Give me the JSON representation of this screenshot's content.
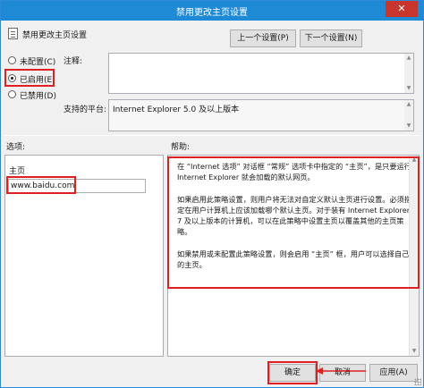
{
  "window": {
    "title": "禁用更改主页设置",
    "close_glyph": "✕"
  },
  "header": {
    "policy_name": "禁用更改主页设置",
    "prev_setting_label": "上一个设置(P)",
    "next_setting_label": "下一个设置(N)"
  },
  "state_options": [
    {
      "label": "未配置(C)",
      "checked": false
    },
    {
      "label": "已启用(E)",
      "checked": true
    },
    {
      "label": "已禁用(D)",
      "checked": false
    }
  ],
  "comment": {
    "label": "注释:",
    "value": ""
  },
  "supported_on": {
    "label": "支持的平台:",
    "value": "Internet Explorer 5.0 及以上版本"
  },
  "options_section": {
    "label": "选项:",
    "homepage_label": "主页",
    "homepage_value": "www.baidu.com"
  },
  "help_section": {
    "label": "帮助:",
    "text": "在 “Internet 选项” 对话框 “常规” 选项卡中指定的 “主页”，是只要运行 Internet Explorer 就会加载的默认网页。\n\n如果启用此策略设置，则用户将无法对自定义默认主页进行设置。必须指定在用户计算机上应该加载哪个默认主页。对于装有 Internet Explorer 7 及以上版本的计算机，可以在此策略中设置主页以覆盖其他的主页策略。\n\n如果禁用或未配置此策略设置，则会启用 “主页” 框，用户可以选择自己的主页。"
  },
  "footer": {
    "ok_label": "确定",
    "cancel_label": "取消",
    "apply_label": "应用(A)"
  },
  "colors": {
    "titlebar": "#1e8ad6",
    "highlight": "#e02020",
    "close_button": "#c7352c"
  }
}
